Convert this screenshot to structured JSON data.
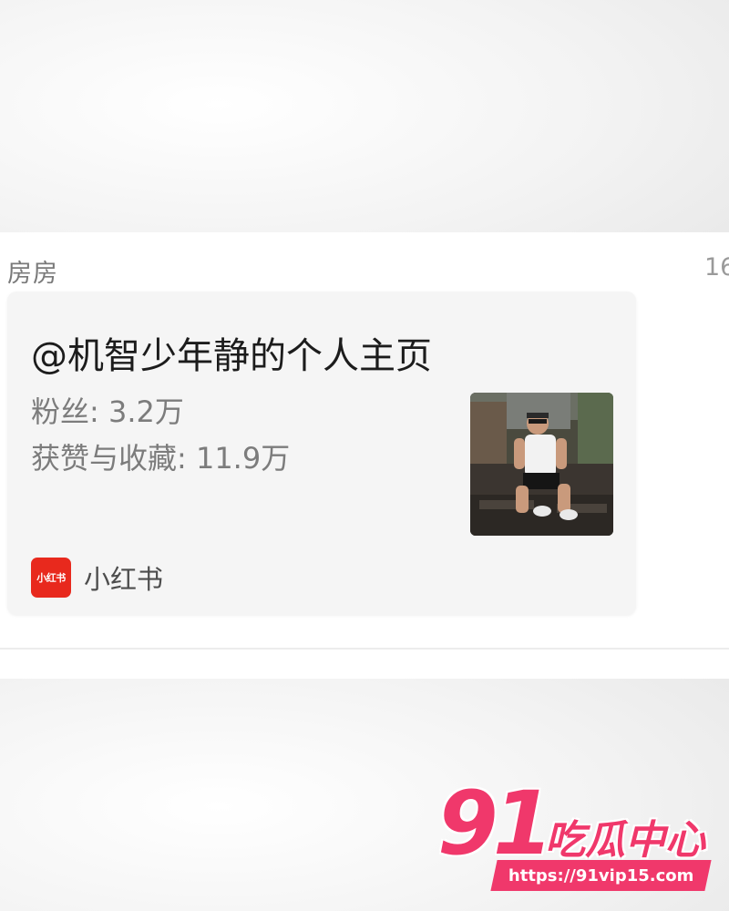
{
  "message": {
    "sender": "房房",
    "right_partial_text": "16"
  },
  "card": {
    "title": "@机智少年静的个人主页",
    "stats": {
      "followers": "粉丝: 3.2万",
      "likes_and_saves": "获赞与收藏: 11.9万"
    },
    "source": {
      "logo_text": "小红书",
      "name": "小红书"
    },
    "colors": {
      "logo_red": "#e8291d"
    }
  },
  "watermark": {
    "number": "91",
    "text": "吃瓜中心",
    "url": "https://91vip15.com",
    "color": "#f0386b"
  }
}
